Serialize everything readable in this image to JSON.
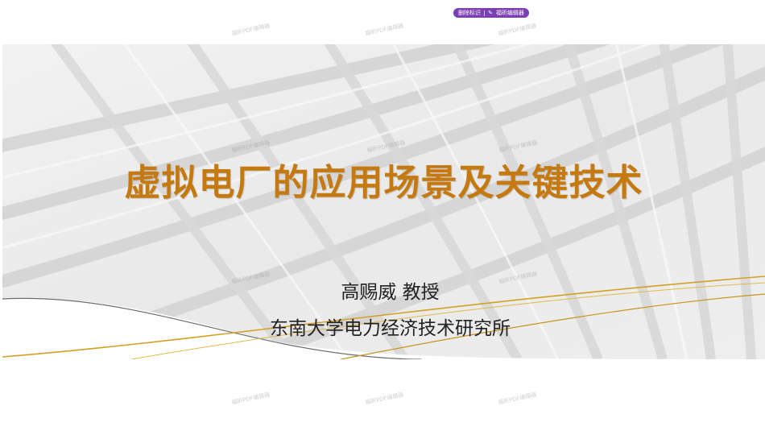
{
  "toolbar": {
    "remove_mark_label": "删除标识",
    "editor_label": "福昕编辑器",
    "editor_icon": "pen-icon"
  },
  "watermark": {
    "text": "福昕PDF编辑器"
  },
  "slide": {
    "title": "虚拟电厂的应用场景及关键技术",
    "author": "高赐威 教授",
    "institute": "东南大学电力经济技术研究所"
  },
  "colors": {
    "title": "#c47a10",
    "toolbar": "#7b3fb3",
    "gold_curve": "#d4a020",
    "text": "#222222"
  }
}
